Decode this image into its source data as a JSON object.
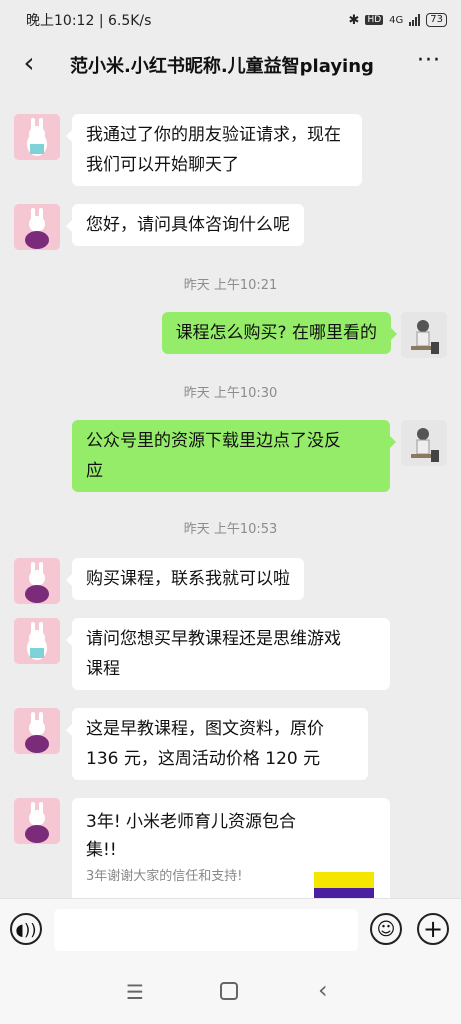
{
  "status_bar": {
    "time": "晚上10:12",
    "speed": "6.5K/s",
    "network": "4G",
    "battery": "73"
  },
  "header": {
    "title": "范小米.小红书昵称.儿童益智playing",
    "back_icon": "chevron-left-icon",
    "more_icon": "ellipsis-icon"
  },
  "messages": [
    {
      "side": "in",
      "text_lines": [
        "我通过了你的朋友验证请求，现在",
        "我们可以开始聊天了"
      ]
    },
    {
      "side": "in",
      "text": "您好，请问具体咨询什么呢"
    },
    {
      "side": "out",
      "text": "课程怎么购买? 在哪里看的"
    },
    {
      "side": "out",
      "text_lines": [
        "公众号里的资源下载里边点了没反",
        "应"
      ]
    },
    {
      "side": "in",
      "text": "购买课程，联系我就可以啦"
    },
    {
      "side": "in",
      "text_lines": [
        "请问您想买早教课程还是思维游戏",
        "课程"
      ]
    },
    {
      "side": "in",
      "text_lines": [
        "这是早教课程，图文资料，原价",
        "136 元，这周活动价格 120 元"
      ]
    },
    {
      "side": "in",
      "card": {
        "title_lines": [
          "3年! 小米老师育儿资源包合",
          "集!!"
        ],
        "subtitle": "3年谢谢大家的信任和支持!"
      }
    }
  ],
  "timestamps": [
    "昨天 上午10:21",
    "昨天 上午10:30",
    "昨天 上午10:53"
  ],
  "input_bar": {
    "placeholder": "",
    "voice_icon": "voice-icon",
    "emoji_icon": "emoji-icon",
    "plus_icon": "plus-icon"
  },
  "nav_bar": {
    "menu_icon": "menu-icon",
    "home_icon": "home-icon",
    "back_icon": "back-icon"
  },
  "colors": {
    "background": "#ededed",
    "incoming_bubble": "#ffffff",
    "outgoing_bubble": "#95ec69",
    "timestamp": "#8c8c8c"
  }
}
